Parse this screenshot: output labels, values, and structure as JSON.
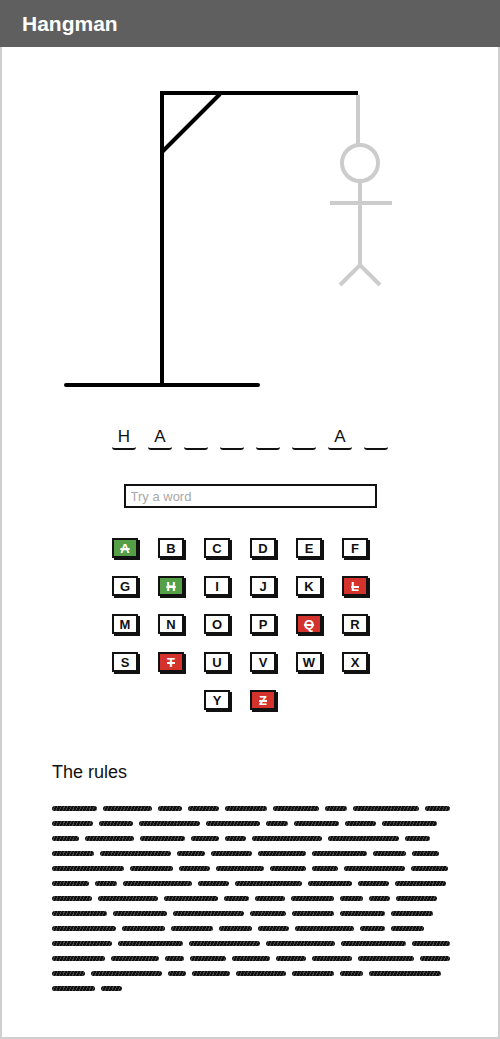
{
  "window": {
    "title": "Hangman"
  },
  "gallows": {
    "parts": [
      {
        "kind": "base",
        "revealed": true
      },
      {
        "kind": "pole",
        "revealed": true
      },
      {
        "kind": "beam",
        "revealed": true
      },
      {
        "kind": "brace",
        "revealed": true
      },
      {
        "kind": "rope",
        "revealed": false
      },
      {
        "kind": "head",
        "revealed": false
      },
      {
        "kind": "body",
        "revealed": false
      },
      {
        "kind": "arms",
        "revealed": false
      },
      {
        "kind": "legs",
        "revealed": false
      }
    ]
  },
  "word": [
    {
      "letter": "H"
    },
    {
      "letter": "A"
    },
    {
      "letter": ""
    },
    {
      "letter": ""
    },
    {
      "letter": ""
    },
    {
      "letter": ""
    },
    {
      "letter": "A"
    },
    {
      "letter": ""
    }
  ],
  "guess": {
    "placeholder": "Try a word"
  },
  "keys": [
    {
      "letter": "A",
      "guessed": true,
      "correct": true
    },
    {
      "letter": "B",
      "guessed": false,
      "correct": false
    },
    {
      "letter": "C",
      "guessed": false,
      "correct": false
    },
    {
      "letter": "D",
      "guessed": false,
      "correct": false
    },
    {
      "letter": "E",
      "guessed": false,
      "correct": false
    },
    {
      "letter": "F",
      "guessed": false,
      "correct": false
    },
    {
      "letter": "G",
      "guessed": false,
      "correct": false
    },
    {
      "letter": "H",
      "guessed": true,
      "correct": true
    },
    {
      "letter": "I",
      "guessed": false,
      "correct": false
    },
    {
      "letter": "J",
      "guessed": false,
      "correct": false
    },
    {
      "letter": "K",
      "guessed": false,
      "correct": false
    },
    {
      "letter": "L",
      "guessed": true,
      "correct": false
    },
    {
      "letter": "M",
      "guessed": false,
      "correct": false
    },
    {
      "letter": "N",
      "guessed": false,
      "correct": false
    },
    {
      "letter": "O",
      "guessed": false,
      "correct": false
    },
    {
      "letter": "P",
      "guessed": false,
      "correct": false
    },
    {
      "letter": "Q",
      "guessed": true,
      "correct": false
    },
    {
      "letter": "R",
      "guessed": false,
      "correct": false
    },
    {
      "letter": "S",
      "guessed": false,
      "correct": false
    },
    {
      "letter": "T",
      "guessed": true,
      "correct": false
    },
    {
      "letter": "U",
      "guessed": false,
      "correct": false
    },
    {
      "letter": "V",
      "guessed": false,
      "correct": false
    },
    {
      "letter": "W",
      "guessed": false,
      "correct": false
    },
    {
      "letter": "X",
      "guessed": false,
      "correct": false
    },
    {
      "letter": "Y",
      "guessed": false,
      "correct": false
    },
    {
      "letter": "Z",
      "guessed": true,
      "correct": false
    }
  ],
  "rules": {
    "title": "The rules"
  }
}
